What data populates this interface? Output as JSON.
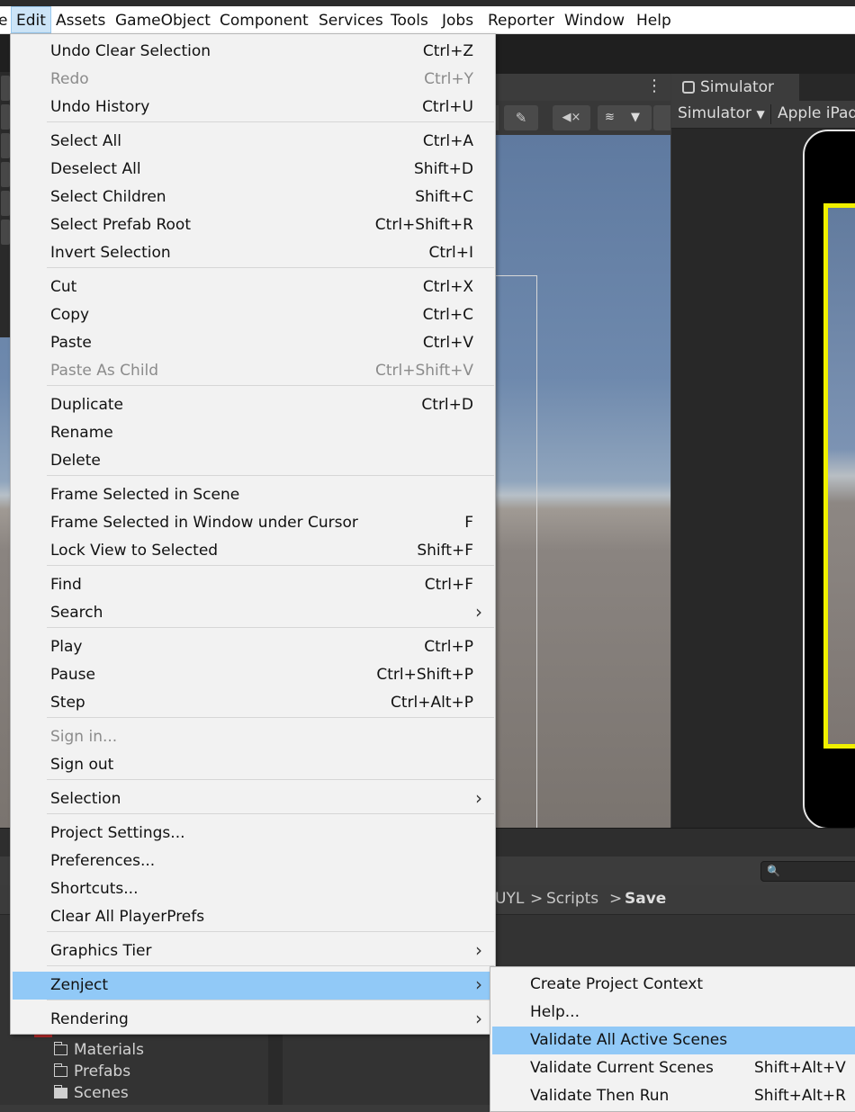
{
  "menubar": {
    "items": [
      "e",
      "Edit",
      "Assets",
      "GameObject",
      "Component",
      "Services",
      "Tools",
      "Jobs",
      "Reporter",
      "Window",
      "Help"
    ],
    "active_index": 1
  },
  "simulator": {
    "tab_label": "Simulator",
    "mode_dropdown": "Simulator",
    "device_dropdown": "Apple iPad"
  },
  "project": {
    "breadcrumb": [
      "UYL",
      "Scripts",
      "Save"
    ],
    "breadcrumb_separator": ">",
    "search_icon_glyph": "🔍",
    "folders": [
      "Materials",
      "Prefabs",
      "Scenes"
    ]
  },
  "edit_menu": {
    "items": [
      {
        "label": "Undo Clear Selection",
        "shortcut": "Ctrl+Z"
      },
      {
        "label": "Redo",
        "shortcut": "Ctrl+Y",
        "disabled": true
      },
      {
        "label": "Undo History",
        "shortcut": "Ctrl+U"
      },
      {
        "label": "Select All",
        "shortcut": "Ctrl+A"
      },
      {
        "label": "Deselect All",
        "shortcut": "Shift+D"
      },
      {
        "label": "Select Children",
        "shortcut": "Shift+C"
      },
      {
        "label": "Select Prefab Root",
        "shortcut": "Ctrl+Shift+R"
      },
      {
        "label": "Invert Selection",
        "shortcut": "Ctrl+I"
      },
      {
        "label": "Cut",
        "shortcut": "Ctrl+X"
      },
      {
        "label": "Copy",
        "shortcut": "Ctrl+C"
      },
      {
        "label": "Paste",
        "shortcut": "Ctrl+V"
      },
      {
        "label": "Paste As Child",
        "shortcut": "Ctrl+Shift+V",
        "disabled": true
      },
      {
        "label": "Duplicate",
        "shortcut": "Ctrl+D"
      },
      {
        "label": "Rename",
        "shortcut": ""
      },
      {
        "label": "Delete",
        "shortcut": ""
      },
      {
        "label": "Frame Selected in Scene",
        "shortcut": ""
      },
      {
        "label": "Frame Selected in Window under Cursor",
        "shortcut": "F"
      },
      {
        "label": "Lock View to Selected",
        "shortcut": "Shift+F"
      },
      {
        "label": "Find",
        "shortcut": "Ctrl+F"
      },
      {
        "label": "Search",
        "shortcut": "",
        "submenu": true
      },
      {
        "label": "Play",
        "shortcut": "Ctrl+P"
      },
      {
        "label": "Pause",
        "shortcut": "Ctrl+Shift+P"
      },
      {
        "label": "Step",
        "shortcut": "Ctrl+Alt+P"
      },
      {
        "label": "Sign in...",
        "shortcut": "",
        "disabled": true
      },
      {
        "label": "Sign out",
        "shortcut": ""
      },
      {
        "label": "Selection",
        "shortcut": "",
        "submenu": true
      },
      {
        "label": "Project Settings...",
        "shortcut": ""
      },
      {
        "label": "Preferences...",
        "shortcut": ""
      },
      {
        "label": "Shortcuts...",
        "shortcut": ""
      },
      {
        "label": "Clear All PlayerPrefs",
        "shortcut": ""
      },
      {
        "label": "Graphics Tier",
        "shortcut": "",
        "submenu": true
      },
      {
        "label": "Zenject",
        "shortcut": "",
        "submenu": true,
        "highlighted": true
      },
      {
        "label": "Rendering",
        "shortcut": "",
        "submenu": true
      }
    ],
    "submenu_arrow": "›"
  },
  "zenject_submenu": {
    "items": [
      {
        "label": "Create Project Context",
        "shortcut": ""
      },
      {
        "label": "Help...",
        "shortcut": ""
      },
      {
        "label": "Validate All Active Scenes",
        "shortcut": "",
        "highlighted": true
      },
      {
        "label": "Validate Current Scenes",
        "shortcut": "Shift+Alt+V"
      },
      {
        "label": "Validate Then Run",
        "shortcut": "Shift+Alt+R"
      }
    ]
  }
}
